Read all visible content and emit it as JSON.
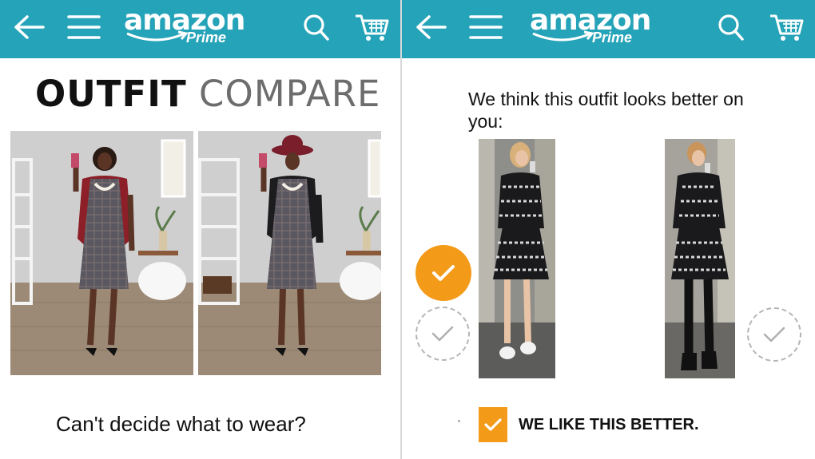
{
  "left_panel": {
    "header": {
      "back_icon": "arrow-left-icon",
      "menu_icon": "hamburger-menu-icon",
      "logo_text": "amazon",
      "logo_subtext": "Prime",
      "search_icon": "search-icon",
      "cart_icon": "cart-icon"
    },
    "title_bold": "OUTFIT",
    "title_light": "COMPARE",
    "question": "Can't decide what to wear?"
  },
  "right_panel": {
    "header": {
      "back_icon": "arrow-left-icon",
      "menu_icon": "hamburger-menu-icon",
      "logo_text": "amazon",
      "logo_subtext": "Prime",
      "search_icon": "search-icon",
      "cart_icon": "cart-icon"
    },
    "prompt": "We think this outfit looks better on you:",
    "like_label": "WE LIKE THIS BETTER."
  },
  "colors": {
    "header_bg": "#25a3b8",
    "accent_orange": "#f39a19",
    "title_gray": "#6d6d6d"
  }
}
